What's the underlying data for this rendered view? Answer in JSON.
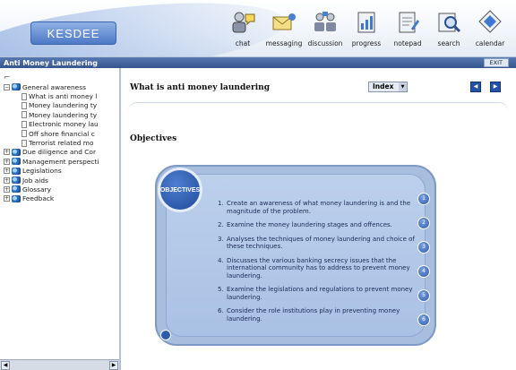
{
  "app": {
    "logo_text": "KESDEE",
    "module_title": "Anti Money Laundering",
    "exit_label": "EXIT"
  },
  "toolbar": [
    {
      "label": "chat",
      "icon": "chat-icon"
    },
    {
      "label": "messaging",
      "icon": "messaging-icon"
    },
    {
      "label": "discussion",
      "icon": "discussion-icon"
    },
    {
      "label": "progress",
      "icon": "progress-icon"
    },
    {
      "label": "notepad",
      "icon": "notepad-icon"
    },
    {
      "label": "search",
      "icon": "search-icon"
    },
    {
      "label": "calendar",
      "icon": "calendar-icon"
    }
  ],
  "tree": {
    "root": "General awareness",
    "children": [
      "What is anti money l",
      "Money laundering ty",
      "Money laundering ty",
      "Electronic money lau",
      "Off shore financial c",
      "Terrorist related mo"
    ],
    "nodes": [
      "Due diligence and Cor",
      "Management perspecti",
      "Legislations",
      "Job aids",
      "Glossary",
      "Feedback"
    ]
  },
  "content": {
    "title": "What is anti money laundering",
    "index_label": "Index",
    "section_title": "Objectives",
    "badge": "OBJECTIVES",
    "objectives": [
      "Create an awareness of what money laundering is and the magnitude of the problem.",
      "Examine the money laundering stages and offences.",
      "Analyses the techniques of money laundering and choice of these techniques.",
      "Discusses the various banking secrecy issues that the international community has to address to prevent money laundering.",
      "Examine the legislations and regulations to prevent money laundering.",
      "Consider the role institutions play in preventing money laundering."
    ]
  }
}
